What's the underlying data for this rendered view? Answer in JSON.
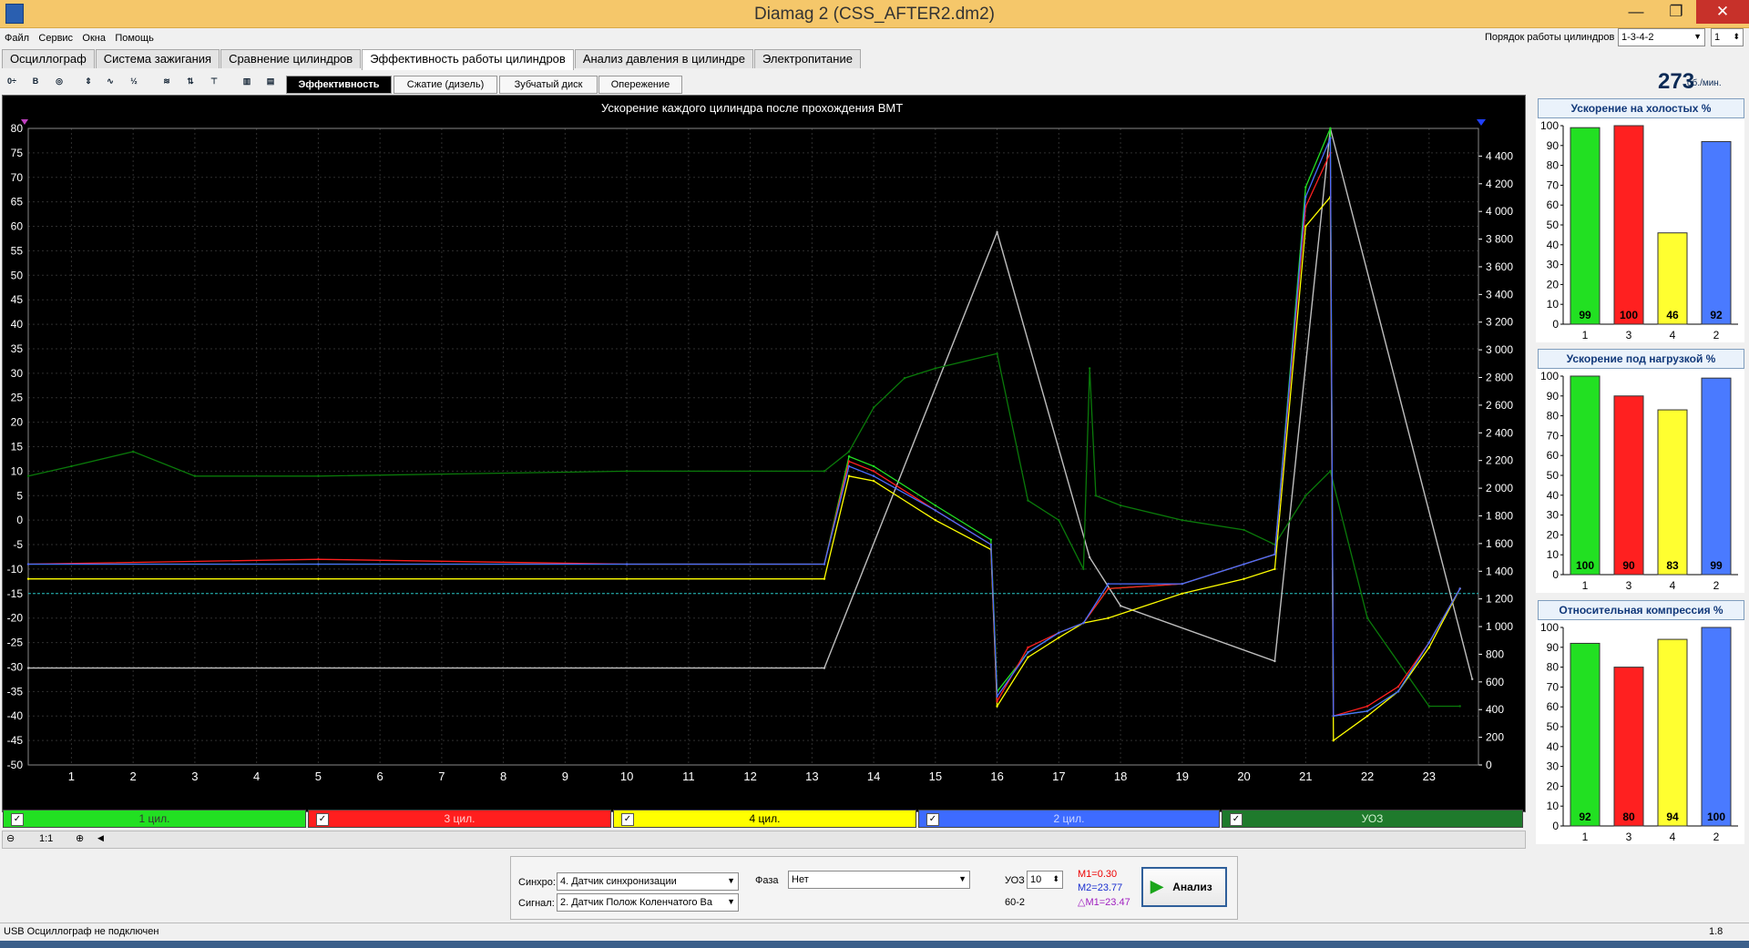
{
  "window": {
    "title": "Diamag 2 (CSS_AFTER2.dm2)",
    "min": "—",
    "max": "❐",
    "close": "✕"
  },
  "menu": [
    "Файл",
    "Сервис",
    "Окна",
    "Помощь"
  ],
  "cyl_order": {
    "label": "Порядок работы цилиндров",
    "value": "1-3-4-2",
    "spin_value": "1"
  },
  "tabs": [
    "Осциллограф",
    "Система зажигания",
    "Сравнение цилиндров",
    "Эффективность работы цилиндров",
    "Анализ давления в цилиндре",
    "Электропитание"
  ],
  "active_tab": 3,
  "subtabs": [
    "Эффективность",
    "Сжатие (дизель)",
    "Зубчатый диск",
    "Опережение"
  ],
  "rpm": {
    "value": "273",
    "unit": "об./мин."
  },
  "main_chart": {
    "title": "Ускорение каждого цилиндра после прохождения ВМТ",
    "left_ticks": [
      "80",
      "75",
      "70",
      "65",
      "60",
      "55",
      "50",
      "45",
      "40",
      "35",
      "30",
      "25",
      "20",
      "15",
      "10",
      "5",
      "0",
      "-5",
      "-10",
      "-15",
      "-20",
      "-25",
      "-30",
      "-35",
      "-40",
      "-45",
      "-50"
    ],
    "right_ticks": [
      "4 400",
      "4 200",
      "4 000",
      "3 800",
      "3 600",
      "3 400",
      "3 200",
      "3 000",
      "2 800",
      "2 600",
      "2 400",
      "2 200",
      "2 000",
      "1 800",
      "1 600",
      "1 400",
      "1 200",
      "1 000",
      "800",
      "600",
      "400",
      "200",
      "0"
    ],
    "x_ticks": [
      "1",
      "2",
      "3",
      "4",
      "5",
      "6",
      "7",
      "8",
      "9",
      "10",
      "11",
      "12",
      "13",
      "14",
      "15",
      "16",
      "17",
      "18",
      "19",
      "20",
      "21",
      "22",
      "23"
    ],
    "colors": {
      "c1": "#22e022",
      "c3": "#ff2020",
      "c4": "#ffff00",
      "c2": "#4a6cff",
      "uoz": "#0a7a0a",
      "rpm": "#bfbfbf"
    }
  },
  "chart_data": {
    "type": "line",
    "title": "Ускорение каждого цилиндра после прохождения ВМТ",
    "ylim": [
      -50,
      80
    ],
    "y2lim": [
      0,
      4600
    ],
    "xlim": [
      0.3,
      23.8
    ],
    "series": [
      {
        "name": "1 цил.",
        "x": [
          0.3,
          5,
          10,
          13.2,
          13.6,
          14,
          15,
          15.9,
          16,
          16.5,
          17,
          17.4,
          17.8,
          19,
          20,
          20.5,
          21,
          21.4,
          21.45,
          22,
          22.5,
          23,
          23.5
        ],
        "values": [
          -9,
          -9,
          -9,
          -9,
          13,
          11,
          3,
          -4,
          -35,
          -27,
          -23,
          -21,
          -14,
          -13,
          -9,
          -7,
          68,
          80,
          -40,
          -39,
          -35,
          -25,
          -14
        ]
      },
      {
        "name": "3 цил.",
        "x": [
          0.3,
          5,
          10,
          13.2,
          13.6,
          14,
          15,
          15.9,
          16,
          16.5,
          17,
          17.4,
          17.8,
          19,
          20,
          20.5,
          21,
          21.4,
          21.45,
          22,
          22.5,
          23,
          23.5
        ],
        "values": [
          -9,
          -8,
          -9,
          -9,
          12,
          10,
          2,
          -5,
          -37,
          -26,
          -23,
          -21,
          -14,
          -13,
          -9,
          -7,
          64,
          75,
          -40,
          -38,
          -34,
          -25,
          -14
        ]
      },
      {
        "name": "4 цил.",
        "x": [
          0.3,
          5,
          10,
          13.2,
          13.6,
          14,
          15,
          15.9,
          16,
          16.5,
          17,
          17.4,
          17.8,
          19,
          20,
          20.5,
          21,
          21.4,
          21.45,
          22,
          22.5,
          23,
          23.5
        ],
        "values": [
          -12,
          -12,
          -12,
          -12,
          9,
          8,
          0,
          -6,
          -38,
          -28,
          -24,
          -21,
          -20,
          -15,
          -12,
          -10,
          60,
          66,
          -45,
          -40,
          -35,
          -26,
          -14
        ]
      },
      {
        "name": "2 цил.",
        "x": [
          0.3,
          5,
          10,
          13.2,
          13.6,
          14,
          15,
          15.9,
          16,
          16.5,
          17,
          17.4,
          17.8,
          19,
          20,
          20.5,
          21,
          21.4,
          21.45,
          22,
          22.5,
          23,
          23.5
        ],
        "values": [
          -9,
          -9,
          -9,
          -9,
          11,
          9,
          2,
          -5,
          -36,
          -27,
          -23,
          -21,
          -13,
          -13,
          -9,
          -7,
          66,
          78,
          -40,
          -39,
          -35,
          -25,
          -14
        ]
      },
      {
        "name": "УОЗ",
        "x": [
          0.3,
          1,
          2,
          3,
          5,
          10,
          13.2,
          13.6,
          14,
          14.5,
          15,
          16,
          16.5,
          17,
          17.4,
          17.5,
          17.6,
          18,
          19,
          20,
          20.5,
          21,
          21.4,
          22,
          23,
          23.5
        ],
        "values": [
          9,
          11,
          14,
          9,
          9,
          10,
          10,
          14,
          23,
          29,
          31,
          34,
          4,
          0,
          -10,
          31,
          5,
          3,
          0,
          -2,
          -5,
          5,
          10,
          -20,
          -38,
          -38
        ]
      },
      {
        "name": "RPM",
        "x": [
          0.3,
          13.2,
          16,
          17.5,
          18,
          20.5,
          21.4,
          23.7
        ],
        "values": [
          700,
          700,
          3850,
          1500,
          1150,
          750,
          4600,
          620
        ]
      }
    ]
  },
  "legend": [
    {
      "label": "1 цил.",
      "bg": "#22e022",
      "fg": "#333",
      "check": "✓"
    },
    {
      "label": "3 цил.",
      "bg": "#ff1e1e",
      "fg": "#ffd0d0",
      "check": "✓"
    },
    {
      "label": "4 цил.",
      "bg": "#ffff00",
      "fg": "#000",
      "check": "✓"
    },
    {
      "label": "2 цил.",
      "bg": "#3d6bff",
      "fg": "#cfd8ff",
      "check": "✓"
    },
    {
      "label": "УОЗ",
      "bg": "#1f7a2c",
      "fg": "#d0f0d0",
      "check": "✓"
    }
  ],
  "zoom": "1:1",
  "bar_panels": [
    {
      "title": "Ускорение на холостых %",
      "categories": [
        "1",
        "3",
        "4",
        "2"
      ],
      "values": [
        99,
        100,
        46,
        92
      ]
    },
    {
      "title": "Ускорение под нагрузкой %",
      "categories": [
        "1",
        "3",
        "4",
        "2"
      ],
      "values": [
        100,
        90,
        83,
        99
      ]
    },
    {
      "title": "Относительная компрессия %",
      "categories": [
        "1",
        "3",
        "4",
        "2"
      ],
      "values": [
        92,
        80,
        94,
        100
      ]
    }
  ],
  "bar_ticks": [
    "100",
    "90",
    "80",
    "70",
    "60",
    "50",
    "40",
    "30",
    "20",
    "10",
    "0"
  ],
  "bar_colors": [
    "#22e022",
    "#ff2020",
    "#ffff30",
    "#4a7aff"
  ],
  "bottom": {
    "sync_label": "Синхро:",
    "sync_value": "4. Датчик синхронизации",
    "signal_label": "Сигнал:",
    "signal_value": "2. Датчик Полож Коленчатого Ва",
    "phase_label": "Фаза",
    "phase_value": "Нет",
    "uoz_label": "УОЗ",
    "uoz_value": "10",
    "wheel": "60-2",
    "m1": "M1=0.30",
    "m2": "M2=23.77",
    "dm": "△M1=23.47",
    "analyze": "Анализ"
  },
  "status": {
    "left": "USB Осциллограф не подключен",
    "right": "1.8"
  }
}
